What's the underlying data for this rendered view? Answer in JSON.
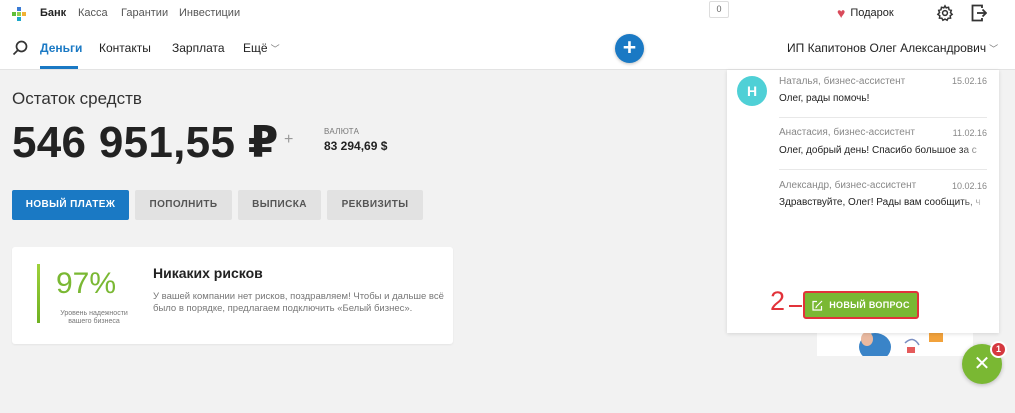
{
  "topbar": {
    "links": [
      "Банк",
      "Касса",
      "Гарантии",
      "Инвестиции"
    ],
    "counter": "0",
    "gift_label": "Подарок"
  },
  "nav": {
    "items": [
      "Деньги",
      "Контакты",
      "Зарплата",
      "Ещё"
    ],
    "user_name": "ИП Капитонов Олег Александрович"
  },
  "balance": {
    "title": "Остаток средств",
    "amount": "546 951,55 ₽",
    "currency_label": "ВАЛЮТА",
    "currency_value": "83 294,69 $"
  },
  "actions": {
    "new_payment": "НОВЫЙ ПЛАТЕЖ",
    "top_up": "ПОПОЛНИТЬ",
    "statement": "ВЫПИСКА",
    "requisites": "РЕКВИЗИТЫ"
  },
  "risk_card": {
    "percent": "97%",
    "caption": "Уровень надежности вашего бизнеса",
    "title": "Никаких рисков",
    "text": "У вашей компании нет рисков, поздравляем! Чтобы и дальше всё было в порядке, предлагаем подключить «Белый бизнес»."
  },
  "chat": {
    "messages": [
      {
        "from": "Наталья, бизнес-ассистент",
        "date": "15.02.16",
        "text": "Олег, рады помочь!",
        "avatar": "Н"
      },
      {
        "from": "Анастасия, бизнес-ассистент",
        "date": "11.02.16",
        "text": "Олег, добрый день! Спасибо большое за с"
      },
      {
        "from": "Александр, бизнес-ассистент",
        "date": "10.02.16",
        "text": "Здравствуйте, Олег! Рады вам сообщить, ч"
      }
    ],
    "new_question": "НОВЫЙ ВОПРОС",
    "step_number": "2"
  },
  "fab": {
    "badge": "1"
  },
  "colors": {
    "brand_blue": "#1a79c4",
    "accent_green": "#7ab833",
    "callout_red": "#e2323a",
    "avatar_teal": "#4fd0d6"
  },
  "icons": [
    "logo-icon",
    "heart-icon",
    "gear-icon",
    "logout-icon",
    "search-icon",
    "plus-icon",
    "chevron-down-icon",
    "edit-icon",
    "close-icon"
  ]
}
